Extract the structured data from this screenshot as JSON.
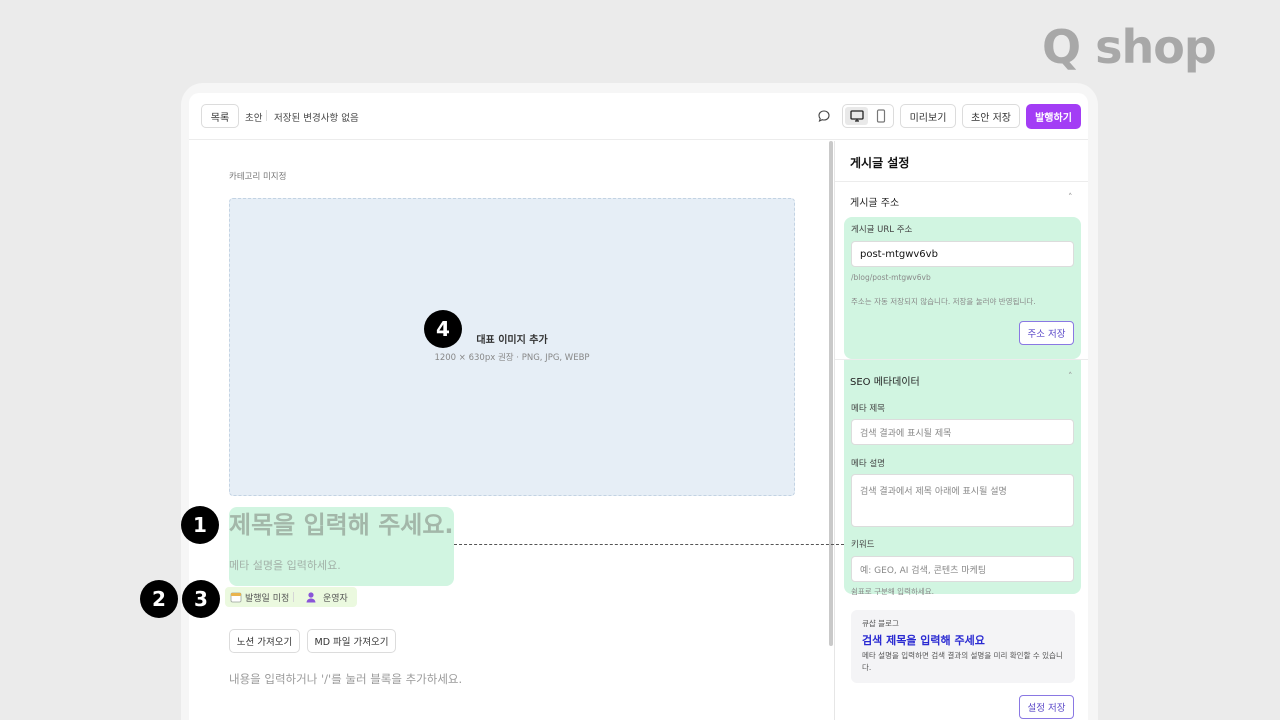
{
  "brand": {
    "logo_text": "Q shop"
  },
  "toolbar": {
    "list_button": "목록",
    "draft_label": "초안",
    "save_status": "저장된 변경사항 없음",
    "preview_button": "미리보기",
    "save_draft_button": "초안 저장",
    "publish_button": "발행하기",
    "accent_color": "#a33df5",
    "icons": [
      "comment-icon",
      "desktop-icon",
      "mobile-icon"
    ]
  },
  "editor": {
    "category": "카테고리 미지정",
    "cover": {
      "title": "대표 이미지 추가",
      "subtitle": "1200 × 630px 권장 · PNG, JPG, WEBP"
    },
    "title_placeholder": "제목을 입력해 주세요.",
    "description_placeholder": "메타 설명을 입력하세요.",
    "publish_date": "발행일 미정",
    "author": "운영자",
    "import_notion": "노션 가져오기",
    "import_md": "MD 파일 가져오기",
    "body_placeholder": "내용을 입력하거나 '/'를 눌러 블록을 추가하세요."
  },
  "panel": {
    "header": "게시글 설정",
    "address_section": {
      "title": "게시글 주소",
      "url_label": "게시글 URL 주소",
      "url_value": "post-mtgwv6vb",
      "path": "/blog/post-mtgwv6vb",
      "note": "주소는 자동 저장되지 않습니다. 저장을 눌러야 반영됩니다.",
      "save_button": "주소 저장"
    },
    "seo_section": {
      "title": "SEO 메타데이터",
      "meta_title_label": "메타 제목",
      "meta_title_placeholder": "검색 결과에 표시될 제목",
      "meta_desc_label": "메타 설명",
      "meta_desc_placeholder": "검색 결과에서 제목 아래에 표시될 설명",
      "keywords_label": "키워드",
      "keywords_placeholder": "예: GEO, AI 검색, 콘텐츠 마케팅",
      "keywords_note": "쉼표로 구분해 입력하세요."
    },
    "preview": {
      "site": "큐샵 블로그",
      "title": "검색 제목을 입력해 주세요",
      "description": "메타 설명을 입력하면 검색 결과의 설명을 미리 확인할 수 있습니다."
    },
    "save_settings_button": "설정 저장"
  },
  "badges": [
    "1",
    "2",
    "3",
    "4"
  ],
  "highlight_color": "#d1f5e1"
}
